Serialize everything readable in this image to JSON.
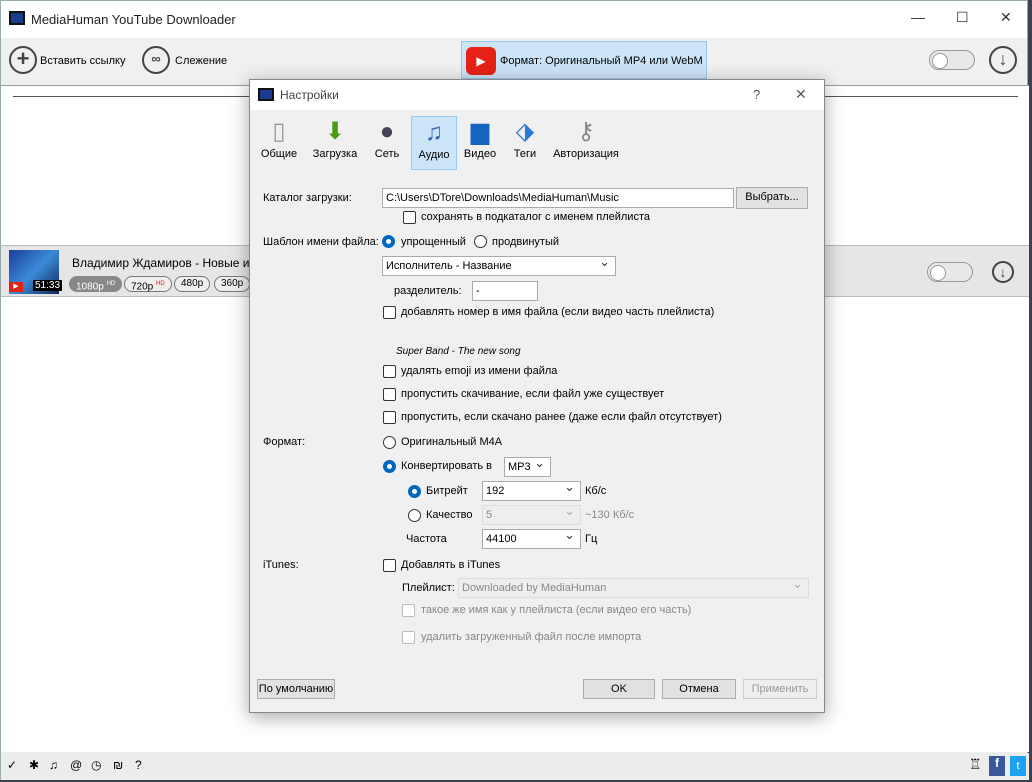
{
  "app": {
    "title": "MediaHuman YouTube Downloader"
  },
  "toolbar": {
    "paste": "Вставить ссылку",
    "tracking": "Слежение",
    "format": "Формат: Оригинальный MP4 или WebM"
  },
  "item": {
    "title": "Владимир Ждамиров - Новые и Луч",
    "duration": "51:33",
    "qualities": [
      {
        "label": "1080p",
        "badge": "HD"
      },
      {
        "label": "720p",
        "badge": "HD"
      },
      {
        "label": "480p"
      },
      {
        "label": "360p"
      }
    ]
  },
  "dialog": {
    "title": "Настройки",
    "help": "?",
    "tabs": [
      {
        "label": "Общие"
      },
      {
        "label": "Загрузка"
      },
      {
        "label": "Сеть"
      },
      {
        "label": "Аудио"
      },
      {
        "label": "Видео"
      },
      {
        "label": "Теги"
      },
      {
        "label": "Авторизация"
      }
    ],
    "active_tab": "Аудио",
    "download_dir_label": "Каталог загрузки:",
    "download_dir": "C:\\Users\\DTore\\Downloads\\MediaHuman\\Music",
    "browse": "Выбрать...",
    "subfolder": "сохранять в подкаталог с именем плейлиста",
    "subfolder_checked": false,
    "template_label": "Шаблон имени файла:",
    "simple": "упрощенный",
    "advanced": "продвинутый",
    "template_mode": "упрощенный",
    "template_value": "Исполнитель - Название",
    "separator_label": "разделитель:",
    "separator": "-",
    "add_number": "добавлять номер в имя файла (если видео часть плейлиста)",
    "example": "Super Band - The new song",
    "remove_emoji": "удалять emoji из имени файла",
    "skip_exists": "пропустить скачивание, если файл уже существует",
    "skip_downloaded": "пропустить, если скачано ранее (даже если файл отсутствует)",
    "format_label": "Формат:",
    "original": "Оригинальный M4A",
    "convert": "Конвертировать в",
    "convert_format": "MP3",
    "format_mode": "Конвертировать в",
    "bitrate_label": "Битрейт",
    "bitrate": "192",
    "kbps": "Кб/с",
    "quality_label": "Качество",
    "quality": "5",
    "quality_hint": "~130 Кб/с",
    "freq_label": "Частота",
    "freq": "44100",
    "hz": "Гц",
    "itunes_label": "iTunes:",
    "add_itunes": "Добавлять в iTunes",
    "playlist_label": "Плейлист:",
    "playlist": "Downloaded by MediaHuman",
    "same_name": "такое же имя как у плейлиста (если видео его часть)",
    "delete_after": "удалить загруженный файл после импорта",
    "defaults": "По умолчанию",
    "ok": "OK",
    "cancel": "Отмена",
    "apply": "Применить"
  },
  "bottom": {
    "help": "?"
  },
  "colors": {
    "accent": "#0067c0",
    "youtube": "#e62117",
    "facebook": "#3b5998",
    "twitter": "#1da1f2"
  }
}
